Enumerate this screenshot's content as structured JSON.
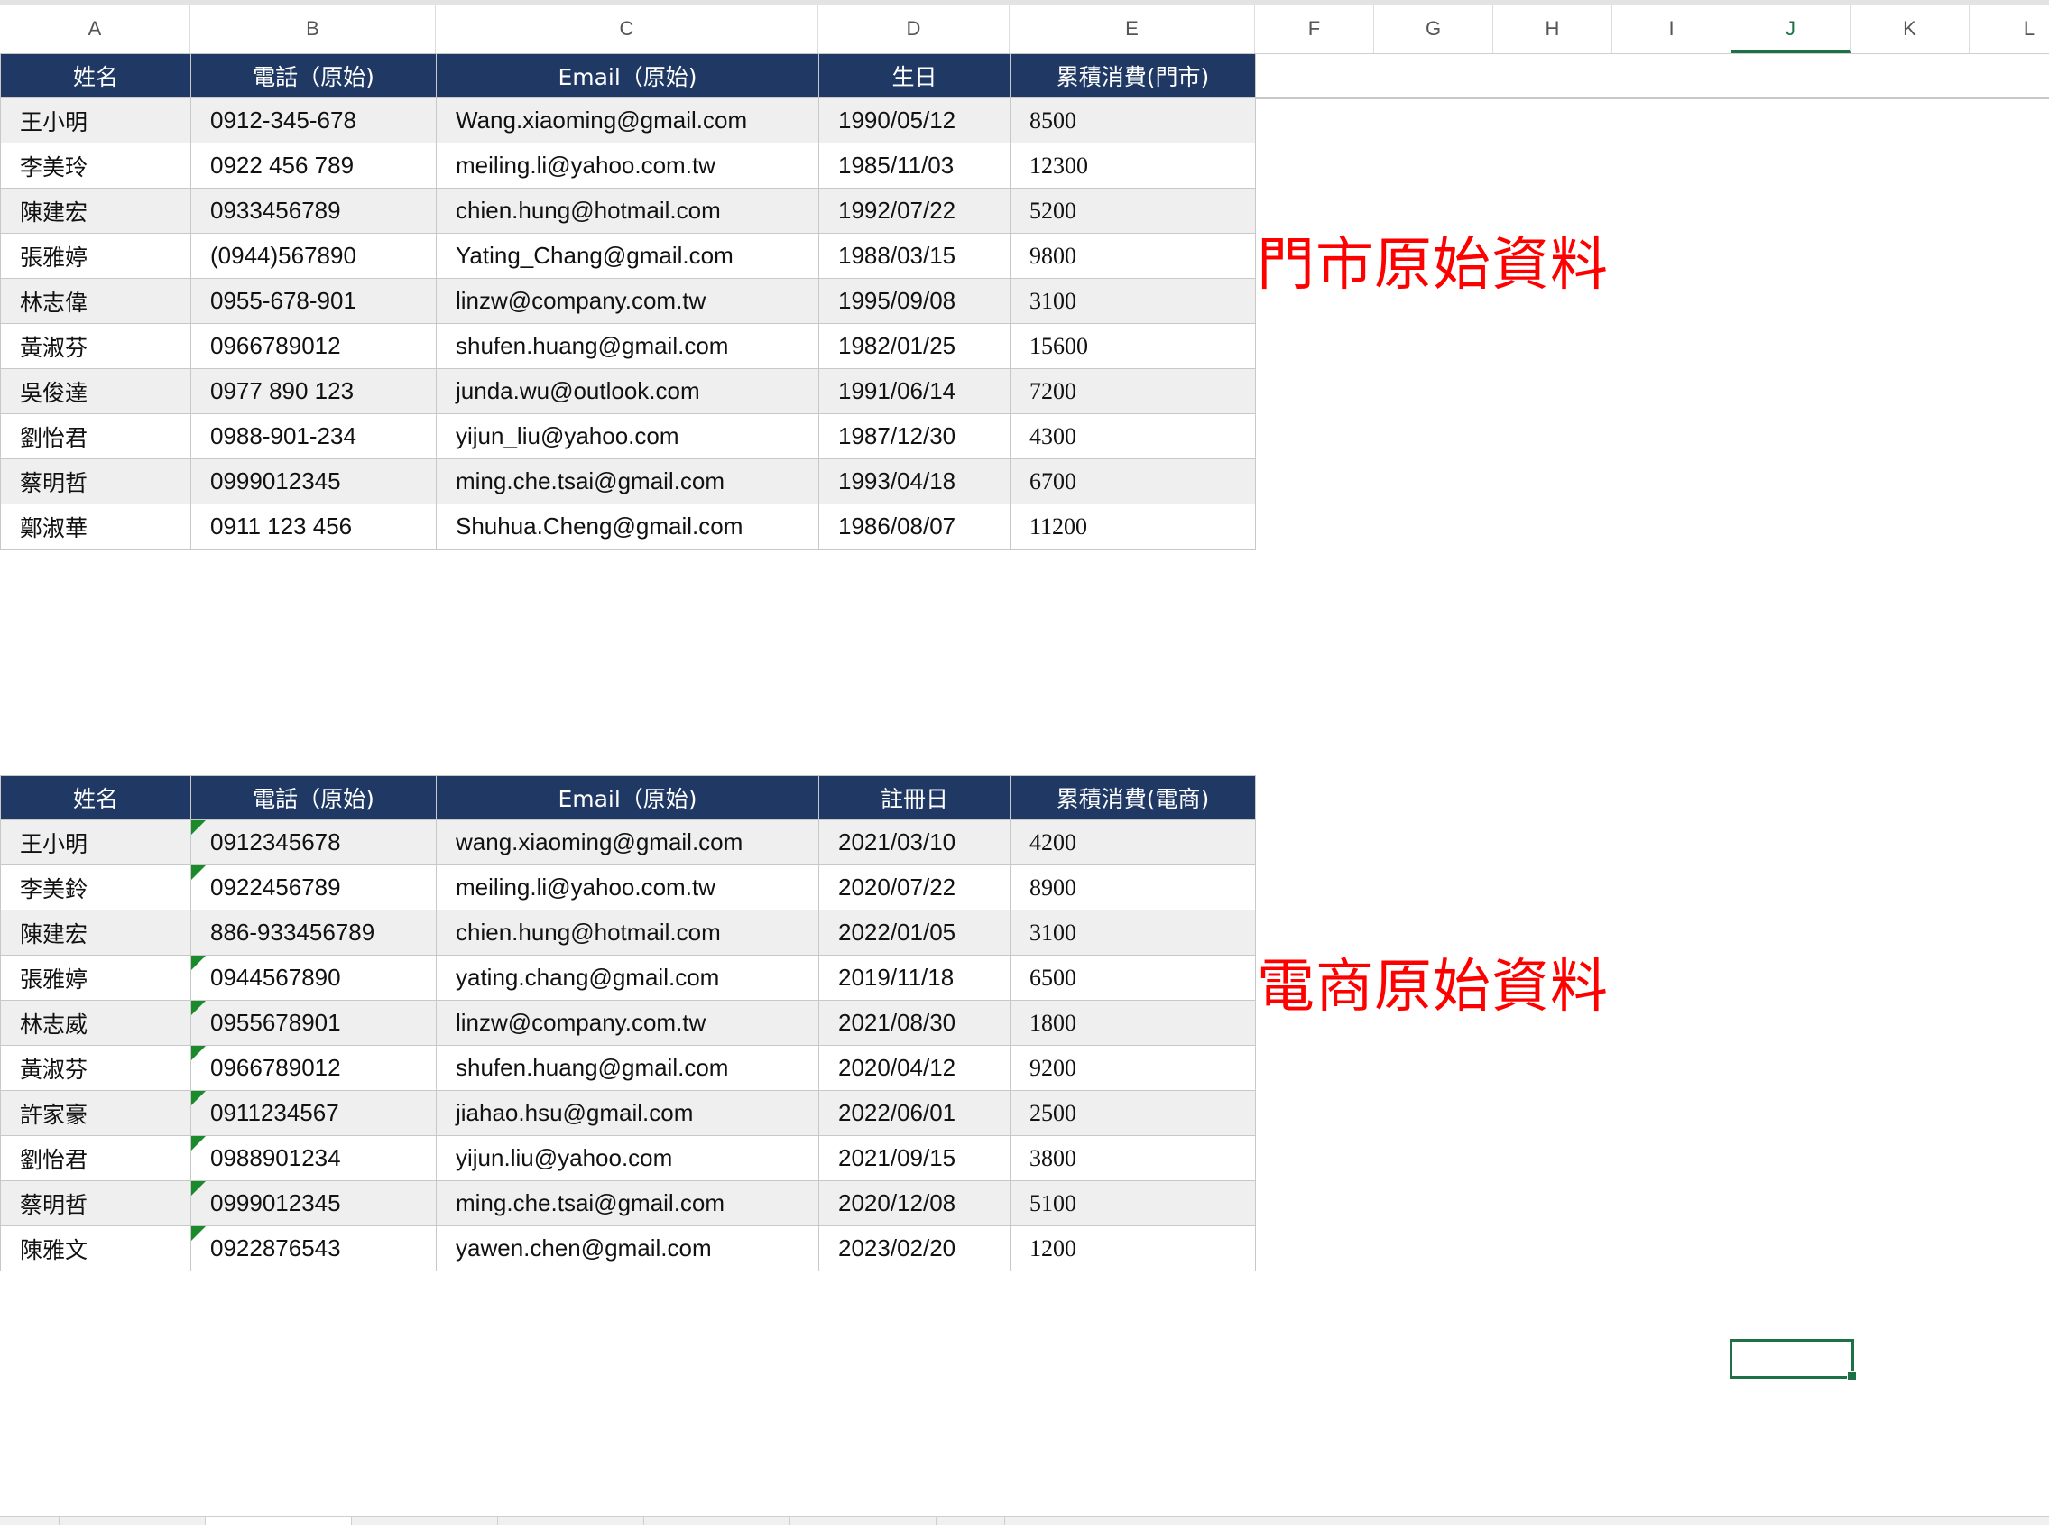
{
  "columns": [
    "A",
    "B",
    "C",
    "D",
    "E",
    "F",
    "G",
    "H",
    "I",
    "J",
    "K",
    "L"
  ],
  "active_column": "J",
  "store_table": {
    "headers": [
      "姓名",
      "電話（原始)",
      "Email（原始)",
      "生日",
      "累積消費(門市)"
    ],
    "rows": [
      {
        "name": "王小明",
        "phone": "0912-345-678",
        "email": "Wang.xiaoming@gmail.com",
        "date": "1990/05/12",
        "amount": "8500"
      },
      {
        "name": "李美玲",
        "phone": "0922 456 789",
        "email": "meiling.li@yahoo.com.tw",
        "date": "1985/11/03",
        "amount": "12300"
      },
      {
        "name": "陳建宏",
        "phone": "0933456789",
        "email": "chien.hung@hotmail.com",
        "date": "1992/07/22",
        "amount": "5200"
      },
      {
        "name": "張雅婷",
        "phone": "(0944)567890",
        "email": "Yating_Chang@gmail.com",
        "date": "1988/03/15",
        "amount": "9800"
      },
      {
        "name": "林志偉",
        "phone": "0955-678-901",
        "email": "linzw@company.com.tw",
        "date": "1995/09/08",
        "amount": "3100"
      },
      {
        "name": "黃淑芬",
        "phone": "0966789012",
        "email": "shufen.huang@gmail.com",
        "date": "1982/01/25",
        "amount": "15600"
      },
      {
        "name": "吳俊達",
        "phone": "0977 890 123",
        "email": "junda.wu@outlook.com",
        "date": "1991/06/14",
        "amount": "7200"
      },
      {
        "name": "劉怡君",
        "phone": "0988-901-234",
        "email": "yijun_liu@yahoo.com",
        "date": "1987/12/30",
        "amount": "4300"
      },
      {
        "name": "蔡明哲",
        "phone": "0999012345",
        "email": "ming.che.tsai@gmail.com",
        "date": "1993/04/18",
        "amount": "6700"
      },
      {
        "name": "鄭淑華",
        "phone": "0911 123 456",
        "email": "Shuhua.Cheng@gmail.com",
        "date": "1986/08/07",
        "amount": "11200"
      }
    ]
  },
  "store_label": "門市原始資料",
  "ecommerce_table": {
    "headers": [
      "姓名",
      "電話（原始)",
      "Email（原始)",
      "註冊日",
      "累積消費(電商)"
    ],
    "rows": [
      {
        "name": "王小明",
        "phone": "0912345678",
        "email": "wang.xiaoming@gmail.com",
        "date": "2021/03/10",
        "amount": "4200",
        "flag": true
      },
      {
        "name": "李美鈴",
        "phone": "0922456789",
        "email": "meiling.li@yahoo.com.tw",
        "date": "2020/07/22",
        "amount": "8900",
        "flag": true
      },
      {
        "name": "陳建宏",
        "phone": "886-933456789",
        "email": "chien.hung@hotmail.com",
        "date": "2022/01/05",
        "amount": "3100",
        "flag": false
      },
      {
        "name": "張雅婷",
        "phone": "0944567890",
        "email": "yating.chang@gmail.com",
        "date": "2019/11/18",
        "amount": "6500",
        "flag": true
      },
      {
        "name": "林志威",
        "phone": "0955678901",
        "email": "linzw@company.com.tw",
        "date": "2021/08/30",
        "amount": "1800",
        "flag": true
      },
      {
        "name": "黃淑芬",
        "phone": "0966789012",
        "email": "shufen.huang@gmail.com",
        "date": "2020/04/12",
        "amount": "9200",
        "flag": true
      },
      {
        "name": "許家豪",
        "phone": "0911234567",
        "email": "jiahao.hsu@gmail.com",
        "date": "2022/06/01",
        "amount": "2500",
        "flag": true
      },
      {
        "name": "劉怡君",
        "phone": "0988901234",
        "email": "yijun.liu@yahoo.com",
        "date": "2021/09/15",
        "amount": "3800",
        "flag": true
      },
      {
        "name": "蔡明哲",
        "phone": "0999012345",
        "email": "ming.che.tsai@gmail.com",
        "date": "2020/12/08",
        "amount": "5100",
        "flag": true
      },
      {
        "name": "陳雅文",
        "phone": "0922876543",
        "email": "yawen.chen@gmail.com",
        "date": "2023/02/20",
        "amount": "1200",
        "flag": true
      }
    ]
  },
  "ecommerce_label": "電商原始資料",
  "colors": {
    "header_bg": "#1f3864",
    "label_red": "#ff0000",
    "selection_green": "#1e7145",
    "error_triangle": "#1a8a2a"
  }
}
